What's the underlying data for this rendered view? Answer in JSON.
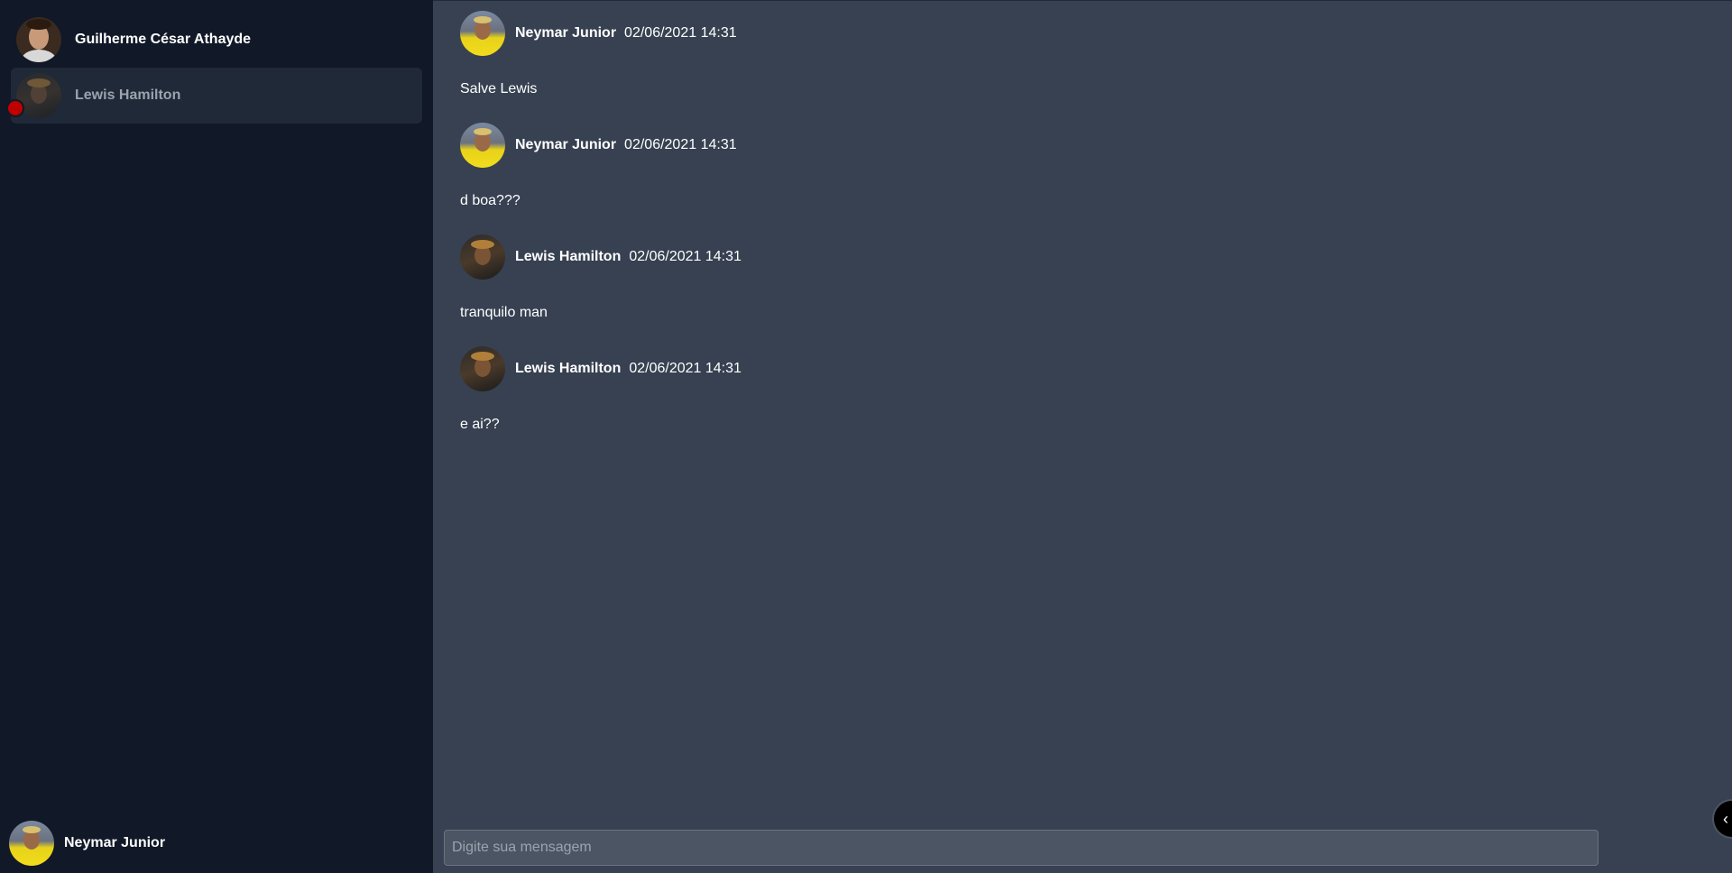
{
  "sidebar": {
    "contacts": [
      {
        "name": "Guilherme César Athayde",
        "avatar_icon": "guilherme-avatar",
        "active": false,
        "unread": false
      },
      {
        "name": "Lewis Hamilton",
        "avatar_icon": "lewis-avatar",
        "active": true,
        "unread": true
      }
    ],
    "current_user": {
      "name": "Neymar Junior",
      "avatar_icon": "neymar-avatar"
    }
  },
  "chat": {
    "messages": [
      {
        "author": "Neymar Junior",
        "time": "02/06/2021 14:31",
        "text": "Salve Lewis"
      },
      {
        "author": "Neymar Junior",
        "time": "02/06/2021 14:31",
        "text": "d boa???"
      },
      {
        "author": "Lewis Hamilton",
        "time": "02/06/2021 14:31",
        "text": "tranquilo man"
      },
      {
        "author": "Lewis Hamilton",
        "time": "02/06/2021 14:31",
        "text": "e ai??"
      }
    ],
    "composer": {
      "placeholder": "Digite sua mensagem",
      "value": ""
    },
    "collapse_icon": "chevron-left-icon"
  },
  "colors": {
    "sidebar_bg": "#111827",
    "chat_bg": "#374151",
    "active_contact_bg": "#1f2937",
    "unread_dot": "#c00000"
  }
}
